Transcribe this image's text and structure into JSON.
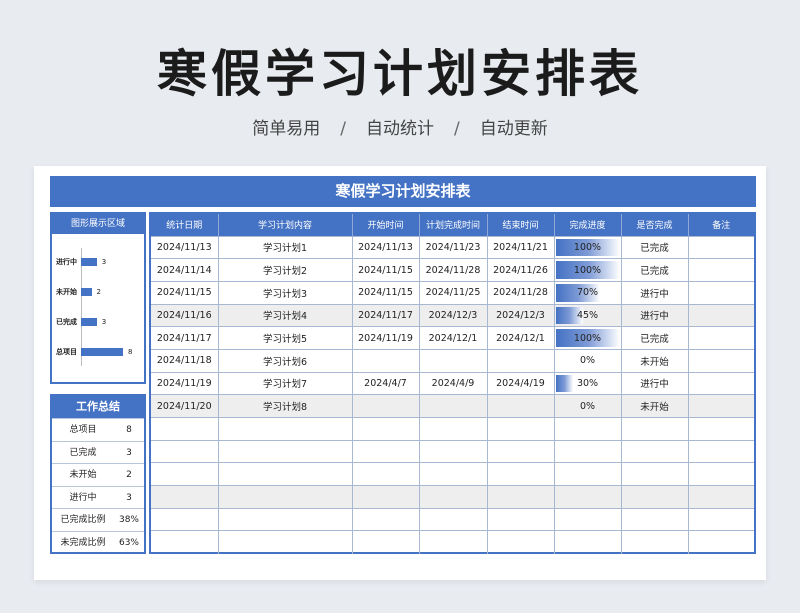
{
  "page": {
    "title": "寒假学习计划安排表",
    "subtitle": [
      "简单易用",
      "自动统计",
      "自动更新"
    ],
    "separator": "/"
  },
  "banner": {
    "title": "寒假学习计划安排表"
  },
  "chart_panel": {
    "title": "图形展示区域",
    "colors": {
      "bar": "#4472c4"
    }
  },
  "chart_data": {
    "type": "bar",
    "orientation": "horizontal",
    "categories": [
      "进行中",
      "未开始",
      "已完成",
      "总项目"
    ],
    "values": [
      3,
      2,
      3,
      8
    ],
    "xlim": [
      0,
      8
    ]
  },
  "summary": {
    "title": "工作总结",
    "rows": [
      {
        "label": "总项目",
        "value": "8"
      },
      {
        "label": "已完成",
        "value": "3"
      },
      {
        "label": "未开始",
        "value": "2"
      },
      {
        "label": "进行中",
        "value": "3"
      },
      {
        "label": "已完成比例",
        "value": "38%"
      },
      {
        "label": "未完成比例",
        "value": "63%"
      }
    ]
  },
  "table": {
    "headers": [
      "统计日期",
      "学习计划内容",
      "开始时间",
      "计划完成时间",
      "结束时间",
      "完成进度",
      "是否完成",
      "备注"
    ],
    "rows": [
      {
        "date": "2024/11/13",
        "content": "学习计划1",
        "start": "2024/11/13",
        "planned": "2024/11/23",
        "end": "2024/11/21",
        "progress": 1.0,
        "progress_text": "100%",
        "status": "已完成",
        "note": ""
      },
      {
        "date": "2024/11/14",
        "content": "学习计划2",
        "start": "2024/11/15",
        "planned": "2024/11/28",
        "end": "2024/11/26",
        "progress": 1.0,
        "progress_text": "100%",
        "status": "已完成",
        "note": ""
      },
      {
        "date": "2024/11/15",
        "content": "学习计划3",
        "start": "2024/11/15",
        "planned": "2024/11/25",
        "end": "2024/11/28",
        "progress": 0.7,
        "progress_text": "70%",
        "status": "进行中",
        "note": ""
      },
      {
        "date": "2024/11/16",
        "content": "学习计划4",
        "start": "2024/11/17",
        "planned": "2024/12/3",
        "end": "2024/12/3",
        "progress": 0.45,
        "progress_text": "45%",
        "status": "进行中",
        "note": ""
      },
      {
        "date": "2024/11/17",
        "content": "学习计划5",
        "start": "2024/11/19",
        "planned": "2024/12/1",
        "end": "2024/12/1",
        "progress": 1.0,
        "progress_text": "100%",
        "status": "已完成",
        "note": ""
      },
      {
        "date": "2024/11/18",
        "content": "学习计划6",
        "start": "",
        "planned": "",
        "end": "",
        "progress": 0,
        "progress_text": "0%",
        "status": "未开始",
        "note": ""
      },
      {
        "date": "2024/11/19",
        "content": "学习计划7",
        "start": "2024/4/7",
        "planned": "2024/4/9",
        "end": "2024/4/19",
        "progress": 0.3,
        "progress_text": "30%",
        "status": "进行中",
        "note": ""
      },
      {
        "date": "2024/11/20",
        "content": "学习计划8",
        "start": "",
        "planned": "",
        "end": "",
        "progress": 0,
        "progress_text": "0%",
        "status": "未开始",
        "note": ""
      }
    ],
    "empty_rows": 6,
    "shaded_rows": [
      3,
      7,
      11
    ]
  }
}
